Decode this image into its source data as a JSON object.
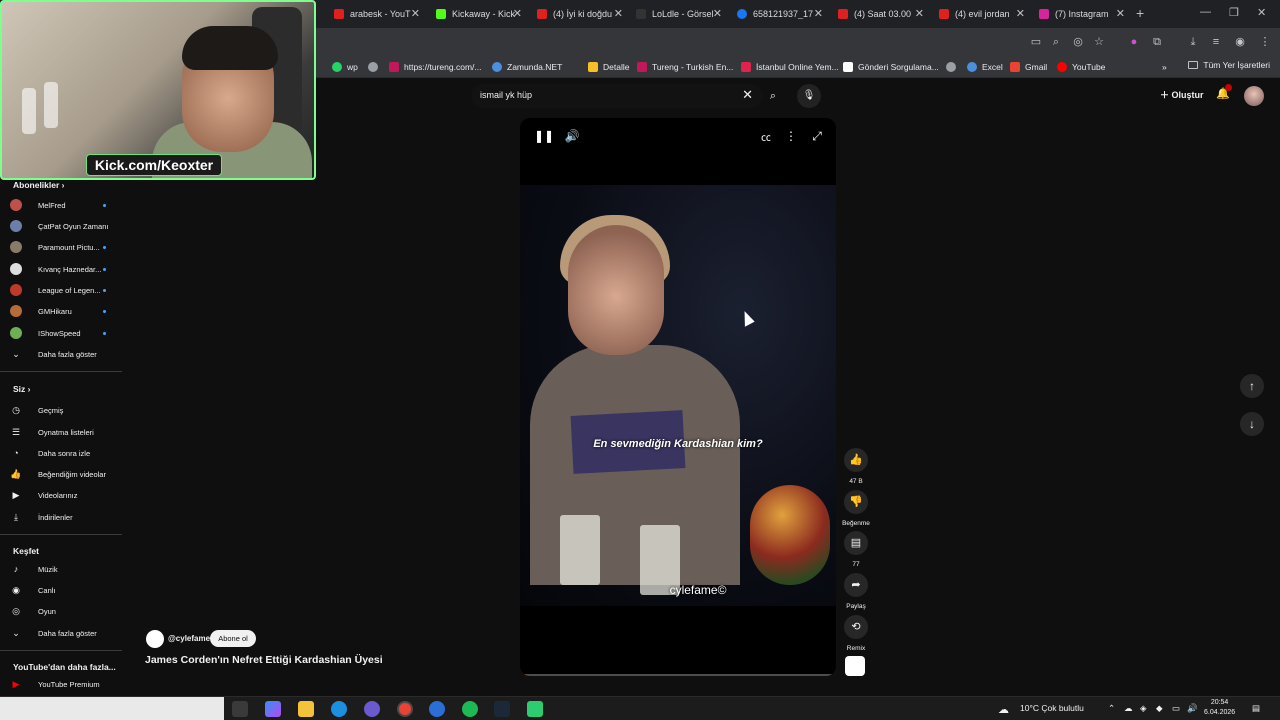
{
  "browser": {
    "tabs": [
      {
        "label": "arabesk - YouT",
        "color": "#e02020"
      },
      {
        "label": "Kickaway - Kick",
        "color": "#53fc18"
      },
      {
        "label": "(4) İyi ki doğdu",
        "color": "#e02020"
      },
      {
        "label": "LoLdle - Görsel",
        "color": "#333333"
      },
      {
        "label": "658121937_17",
        "color": "#1877f2"
      },
      {
        "label": "(4) Saat 03.00",
        "color": "#e02020"
      },
      {
        "label": "(4) evil jordan",
        "color": "#e02020"
      },
      {
        "label": "(7) Instagram",
        "color": "#d6249f"
      }
    ],
    "new_tab_icon": "+",
    "bookmarks": [
      {
        "label": "wp",
        "color": "#25d366"
      },
      {
        "label": "",
        "color": "#9aa0a6"
      },
      {
        "label": "https://tureng.com/...",
        "color": "#c2185b"
      },
      {
        "label": "Zamunda.NET",
        "color": "#4a8fe0"
      },
      {
        "label": "Detalle",
        "color": "#f6c026"
      },
      {
        "label": "Tureng - Turkish En...",
        "color": "#c2185b"
      },
      {
        "label": "İstanbul Online Yem...",
        "color": "#e0224e"
      },
      {
        "label": "Gönderi Sorgulama...",
        "color": "#ffffff"
      },
      {
        "label": "",
        "color": "#9aa0a6"
      },
      {
        "label": "Excel",
        "color": "#4a8fe0"
      },
      {
        "label": "Gmail",
        "color": "#ea4335"
      },
      {
        "label": "YouTube",
        "color": "#ff0000"
      }
    ],
    "bookmarks_more": "»",
    "all_bookmarks": "Tüm Yer İşaretleri"
  },
  "webcam": {
    "label": "Kick.com/Keoxter"
  },
  "youtube": {
    "search": {
      "query": "ismail yk hüp"
    },
    "create_label": "Oluştur",
    "sidebar": {
      "subscriptions_heading": "Abonelikler",
      "subscriptions": [
        {
          "label": "MelFred",
          "color": "#c0504d"
        },
        {
          "label": "ÇatPat Oyun Zamanı",
          "color": "#6b7fa8"
        },
        {
          "label": "Paramount Pictu...",
          "color": "#8a7a6a"
        },
        {
          "label": "Kıvanç Haznedar...",
          "color": "#dddddd"
        },
        {
          "label": "League of Legen...",
          "color": "#c03a2b"
        },
        {
          "label": "GMHikaru",
          "color": "#b56b3a"
        },
        {
          "label": "IShowSpeed",
          "color": "#6fae55"
        }
      ],
      "show_more": "Daha fazla göster",
      "you_heading": "Siz",
      "you_items": [
        {
          "label": "Geçmiş",
          "icon": "history-icon",
          "glyph": "◷"
        },
        {
          "label": "Oynatma listeleri",
          "icon": "playlists-icon",
          "glyph": "☰"
        },
        {
          "label": "Daha sonra izle",
          "icon": "watch-later-icon",
          "glyph": "◔"
        },
        {
          "label": "Beğendiğim videolar",
          "icon": "like-icon",
          "glyph": "👍"
        },
        {
          "label": "Videolarınız",
          "icon": "your-videos-icon",
          "glyph": "▶"
        },
        {
          "label": "İndirilenler",
          "icon": "download-icon",
          "glyph": "⤓"
        }
      ],
      "explore_heading": "Keşfet",
      "explore_items": [
        {
          "label": "Müzik",
          "icon": "music-icon",
          "glyph": "♪"
        },
        {
          "label": "Canlı",
          "icon": "live-icon",
          "glyph": "◉"
        },
        {
          "label": "Oyun",
          "icon": "gaming-icon",
          "glyph": "◎"
        }
      ],
      "explore_show_more": "Daha fazla göster",
      "more_heading": "YouTube'dan daha fazla...",
      "more_items": [
        {
          "label": "YouTube Premium",
          "icon": "youtube-premium-icon",
          "color": "#ff0000"
        }
      ]
    },
    "short": {
      "subtitle": "En sevmediğin Kardashian kim?",
      "watermark": "cylefame©",
      "progress": 0.02,
      "channel": "@cylefame",
      "subscribe_label": "Abone ol",
      "title": "James Corden'ın Nefret Ettiği Kardashian Üyesi",
      "actions": [
        {
          "name": "like",
          "label": "47 B",
          "glyph": "👍"
        },
        {
          "name": "dislike",
          "label": "Beğenme",
          "glyph": "👎"
        },
        {
          "name": "comments",
          "label": "77",
          "glyph": "▤"
        },
        {
          "name": "share",
          "label": "Paylaş",
          "glyph": "➦"
        },
        {
          "name": "remix",
          "label": "Remix",
          "glyph": "⟲"
        }
      ]
    }
  },
  "taskbar": {
    "weather": "10°C  Çok bulutlu",
    "time": "20:54",
    "date": "6.04.2026"
  }
}
